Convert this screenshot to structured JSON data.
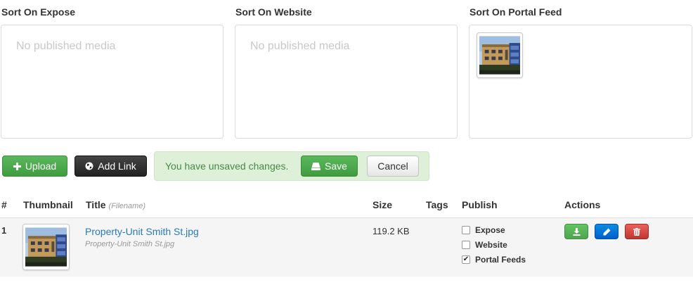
{
  "sort_columns": [
    {
      "title": "Sort On Expose",
      "empty_text": "No published media"
    },
    {
      "title": "Sort On Website",
      "empty_text": "No published media"
    },
    {
      "title": "Sort On Portal Feed",
      "empty_text": ""
    }
  ],
  "toolbar": {
    "upload_label": "Upload",
    "add_link_label": "Add Link",
    "unsaved_text": "You have unsaved changes.",
    "save_label": "Save",
    "cancel_label": "Cancel"
  },
  "table": {
    "headers": {
      "num": "#",
      "thumbnail": "Thumbnail",
      "title": "Title",
      "title_sub": "(Filename)",
      "size": "Size",
      "tags": "Tags",
      "publish": "Publish",
      "actions": "Actions"
    },
    "rows": [
      {
        "num": "1",
        "title": "Property-Unit Smith St.jpg",
        "filename": "Property-Unit Smith St.jpg",
        "size": "119.2 KB",
        "tags": "",
        "publish": {
          "expose": false,
          "website": false,
          "portal_feeds": true
        }
      }
    ]
  },
  "publish_labels": {
    "expose": "Expose",
    "website": "Website",
    "portal_feeds": "Portal Feeds"
  },
  "icons": {
    "upload": "plus-icon",
    "add_link": "globe-icon",
    "save": "hard-drive-icon",
    "download": "download-icon",
    "edit": "pencil-icon",
    "delete": "trash-icon"
  },
  "colors": {
    "success": "#5cb85c",
    "dark": "#333333",
    "primary": "#0069d6",
    "danger": "#d9534f",
    "alert_bg": "#dff0d8",
    "alert_text": "#468847",
    "link": "#2a7ab8"
  }
}
